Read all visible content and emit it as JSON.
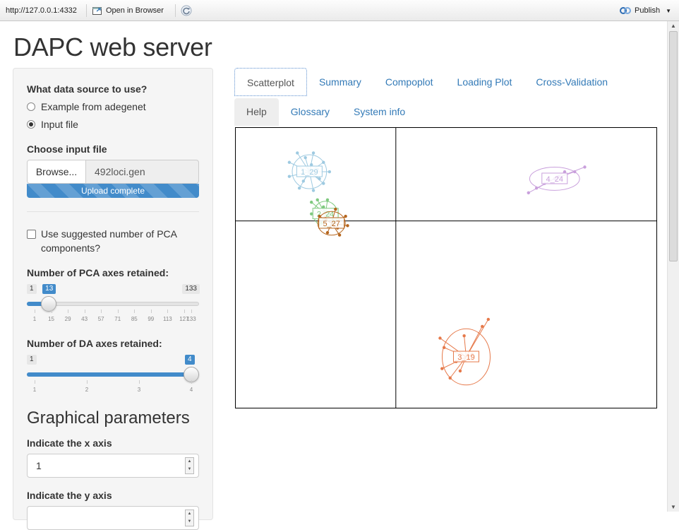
{
  "topbar": {
    "url": "http://127.0.0.1:4332",
    "open_in_browser": "Open in Browser",
    "publish": "Publish"
  },
  "page_title": "DAPC web server",
  "sidebar": {
    "data_source_label": "What data source to use?",
    "data_source_options": [
      "Example from adegenet",
      "Input file"
    ],
    "data_source_selected": "Input file",
    "choose_file_label": "Choose input file",
    "browse_button": "Browse...",
    "file_name": "492loci.gen",
    "upload_status": "Upload complete",
    "upload_progress": 1.0,
    "suggested_pca_label": "Use suggested number of PCA components?",
    "suggested_pca_checked": false,
    "pca_slider": {
      "label": "Number of PCA axes retained:",
      "min": 1,
      "max": 133,
      "value": 13,
      "min_label": "1",
      "max_label": "133",
      "value_label": "13",
      "ticks": [
        "1",
        "15",
        "29",
        "43",
        "57",
        "71",
        "85",
        "99",
        "113",
        "127",
        "133"
      ]
    },
    "da_slider": {
      "label": "Number of DA axes retained:",
      "min": 1,
      "max": 4,
      "value": 4,
      "min_label": "1",
      "value_label": "4",
      "ticks": [
        "1",
        "2",
        "3",
        "4"
      ]
    },
    "graphical_title": "Graphical parameters",
    "x_axis_label": "Indicate the x axis",
    "x_axis_value": "1",
    "y_axis_label": "Indicate the y axis"
  },
  "tabs_row1": [
    "Scatterplot",
    "Summary",
    "Compoplot",
    "Loading Plot",
    "Cross-Validation"
  ],
  "tabs_row2": [
    "Help",
    "Glossary",
    "System info"
  ],
  "active_tab": "Scatterplot",
  "chart_data": {
    "type": "scatter",
    "title": "",
    "xlabel": "",
    "ylabel": "",
    "xlim": [
      -8,
      13
    ],
    "ylim": [
      -8,
      4
    ],
    "grid": true,
    "grid_lines": {
      "x": 0,
      "y": 0
    },
    "legend": "none",
    "clusters": [
      {
        "name": "1_29",
        "color": "#9ecae1",
        "center": [
          -4.3,
          2.1
        ],
        "points": [
          [
            -5.3,
            2.5
          ],
          [
            -4.9,
            2.9
          ],
          [
            -4.1,
            2.9
          ],
          [
            -3.6,
            2.5
          ],
          [
            -3.3,
            2.1
          ],
          [
            -3.6,
            1.6
          ],
          [
            -4.1,
            1.3
          ],
          [
            -4.8,
            1.4
          ],
          [
            -5.3,
            1.9
          ],
          [
            -4.5,
            2.7
          ],
          [
            -3.8,
            1.8
          ],
          [
            -4.6,
            1.7
          ],
          [
            -4.2,
            2.4
          ],
          [
            -3.9,
            2.2
          ]
        ]
      },
      {
        "name": "4_24",
        "color": "#c9a0dc",
        "center": [
          7.9,
          1.8
        ],
        "points": [
          [
            6.6,
            1.2
          ],
          [
            7.0,
            1.4
          ],
          [
            7.4,
            1.6
          ],
          [
            8.4,
            2.1
          ],
          [
            8.9,
            2.1
          ],
          [
            9.4,
            2.3
          ],
          [
            7.9,
            1.8
          ],
          [
            8.1,
            1.9
          ]
        ]
      },
      {
        "name": "2_24",
        "color": "#7fc97f",
        "center": [
          -3.5,
          0.3
        ],
        "points": [
          [
            -4.2,
            0.8
          ],
          [
            -3.9,
            0.9
          ],
          [
            -3.4,
            0.9
          ],
          [
            -3.0,
            0.5
          ],
          [
            -3.1,
            0.0
          ],
          [
            -3.7,
            -0.1
          ],
          [
            -4.2,
            0.3
          ],
          [
            -3.6,
            0.6
          ],
          [
            -3.3,
            0.3
          ]
        ]
      },
      {
        "name": "5_27",
        "color": "#b5651d",
        "center": [
          -3.2,
          -0.1
        ],
        "points": [
          [
            -3.8,
            0.2
          ],
          [
            -3.4,
            -0.5
          ],
          [
            -2.8,
            -0.6
          ],
          [
            -2.4,
            -0.2
          ],
          [
            -2.5,
            0.2
          ],
          [
            -3.0,
            0.5
          ],
          [
            -3.5,
            0.1
          ],
          [
            -2.9,
            -0.3
          ]
        ]
      },
      {
        "name": "3_19",
        "color": "#e6794a",
        "center": [
          3.5,
          -5.8
        ],
        "points": [
          [
            2.2,
            -5.0
          ],
          [
            2.4,
            -5.4
          ],
          [
            2.3,
            -6.3
          ],
          [
            2.7,
            -6.7
          ],
          [
            3.2,
            -6.4
          ],
          [
            3.8,
            -5.7
          ],
          [
            4.3,
            -4.5
          ],
          [
            4.6,
            -4.2
          ],
          [
            3.4,
            -4.9
          ],
          [
            3.0,
            -6.0
          ]
        ]
      }
    ]
  }
}
